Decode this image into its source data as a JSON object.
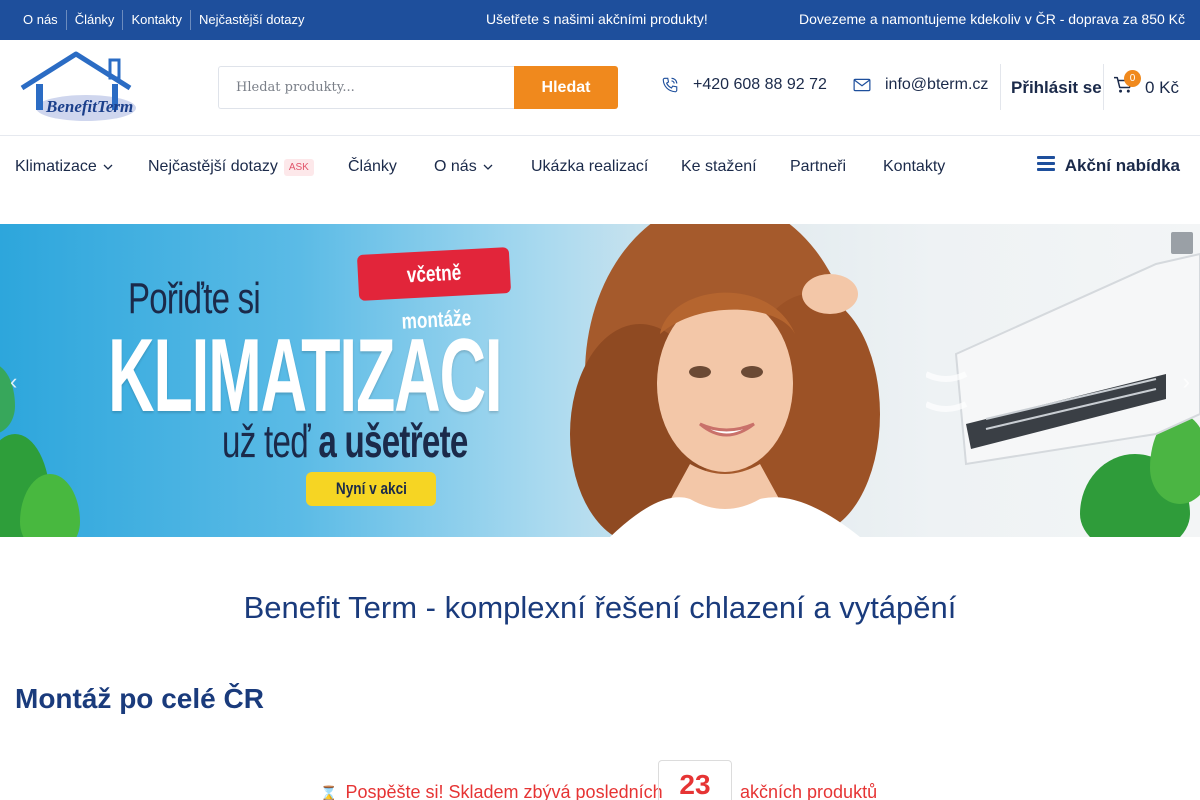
{
  "topbar": {
    "links": [
      "O nás",
      "Články",
      "Kontakty",
      "Nejčastější dotazy"
    ],
    "promo": "Ušetřete s našimi akčními produkty!",
    "delivery": "Dovezeme a namontujeme kdekoliv v ČR - doprava za 850 Kč"
  },
  "header": {
    "logo_text": "BenefitTerm",
    "search_placeholder": "Hledat produkty...",
    "search_button": "Hledat",
    "phone": "+420 608 88 92 72",
    "email": "info@bterm.cz",
    "login": "Přihlásit se",
    "cart_count": "0",
    "cart_total": "0 Kč"
  },
  "nav": {
    "items": [
      "Klimatizace",
      "Nejčastější dotazy",
      "Články",
      "O nás",
      "Ukázka realizací",
      "Ke stažení",
      "Partneři",
      "Kontakty"
    ],
    "ask_badge": "ASK",
    "offers": "Akční nabídka"
  },
  "hero": {
    "line1": "Pořiďte si",
    "line2": "KLIMATIZACI",
    "line3a": "už teď",
    "line3b": "a ušetřete",
    "pill": "včetně montáže",
    "cta": "Nyní v akci"
  },
  "content": {
    "main_title": "Benefit Term - komplexní řešení chlazení a vytápění",
    "sub_title": "Montáž po celé ČR",
    "stock_prefix": "Pospěšte si! Skladem zbývá posledních",
    "stock_count": "23",
    "stock_suffix": "akčních produktů"
  },
  "colors": {
    "topbar": "#1e4f9c",
    "accent": "#f0891d",
    "heading": "#1a3b7c",
    "alert": "#e63434"
  }
}
